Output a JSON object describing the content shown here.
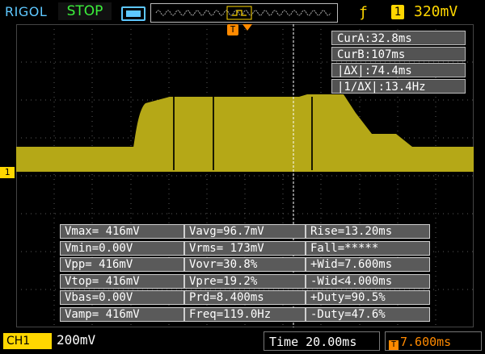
{
  "header": {
    "brand": "RIGOL",
    "run_state": "STOP",
    "trigger_source": "1",
    "trigger_level": "320mV"
  },
  "colors": {
    "waveform": "#b5a817",
    "trigger": "#ffd700",
    "offset": "#ff8a00",
    "run_state": "#3cf03c"
  },
  "marker": {
    "trigger_label": "T",
    "channel_label": "1"
  },
  "cursors": [
    "CurA:32.8ms",
    "CurB:107ms",
    "|ΔX|:74.4ms",
    "|1/ΔX|:13.4Hz"
  ],
  "measurements": [
    [
      "Vmax= 416mV",
      "Vavg=96.7mV",
      "Rise=13.20ms"
    ],
    [
      "Vmin=0.00V",
      "Vrms= 173mV",
      "Fall=*****"
    ],
    [
      "Vpp= 416mV",
      "Vovr=30.8%",
      "+Wid=7.600ms"
    ],
    [
      "Vtop= 416mV",
      "Vpre=19.2%",
      "-Wid<4.000ms"
    ],
    [
      "Vbas=0.00V",
      "Prd=8.400ms",
      "+Duty=90.5%"
    ],
    [
      "Vamp= 416mV",
      "Freq=119.0Hz",
      "-Duty=47.6%"
    ]
  ],
  "footer": {
    "channel": "CH1",
    "volts_div": "200mV",
    "time_div": "Time 20.00ms",
    "trigger_offset_icon": "T",
    "trigger_offset": "7.600ms"
  }
}
